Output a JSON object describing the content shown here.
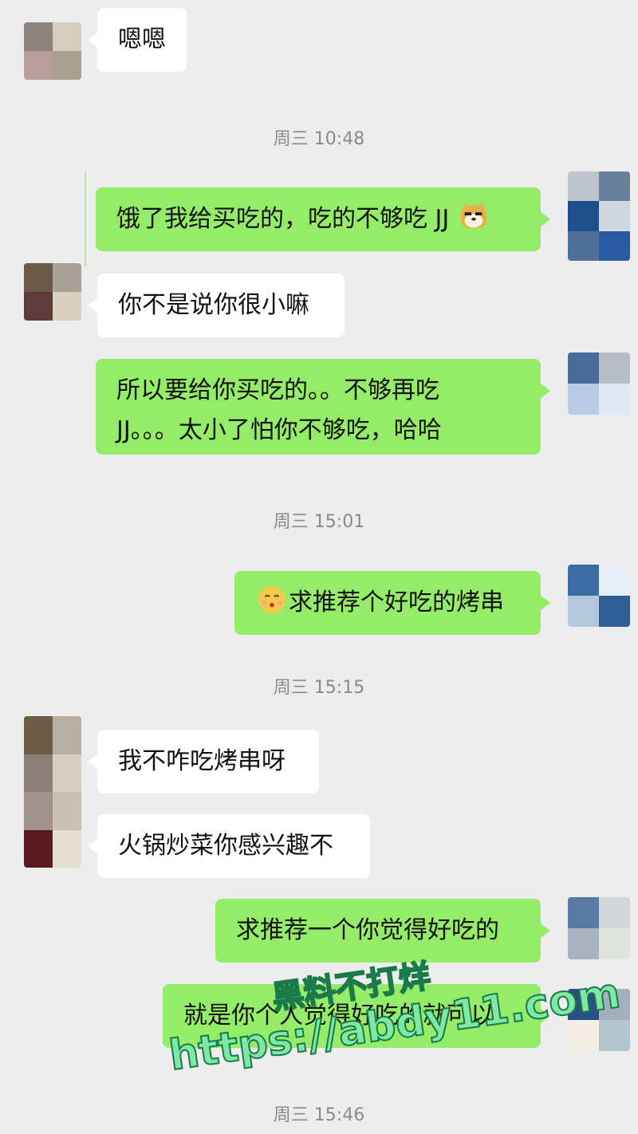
{
  "colors": {
    "background": "#ededed",
    "sent_bubble": "#95ec69",
    "received_bubble": "#ffffff",
    "timestamp_text": "#8a8a8a",
    "watermark_fill": "#7ee8a4"
  },
  "messages": {
    "m1": "嗯嗯",
    "t1": "周三 10:48",
    "m2": "饿了我给买吃的，吃的不够吃 JJ",
    "m3": "你不是说你很小嘛",
    "m4_line1": "所以要给你买吃的。。不够再吃",
    "m4_line2": "JJ。。。太小了怕你不够吃，哈哈",
    "t2": "周三 15:01",
    "m5": "求推荐个好吃的烤串",
    "t3": "周三 15:15",
    "m6": "我不咋吃烤串呀",
    "m7": "火锅炒菜你感兴趣不",
    "m8": "求推荐一个你觉得好吃的",
    "m9": "就是你个人觉得好吃的就可以",
    "t4": "周三 15:46"
  },
  "icons": {
    "m2_emoji": "doge-emoji-icon",
    "m5_emoji": "shush-emoji-icon"
  },
  "watermark": {
    "line1": "黑料不打烊",
    "line2": "https://abdy11.com"
  }
}
